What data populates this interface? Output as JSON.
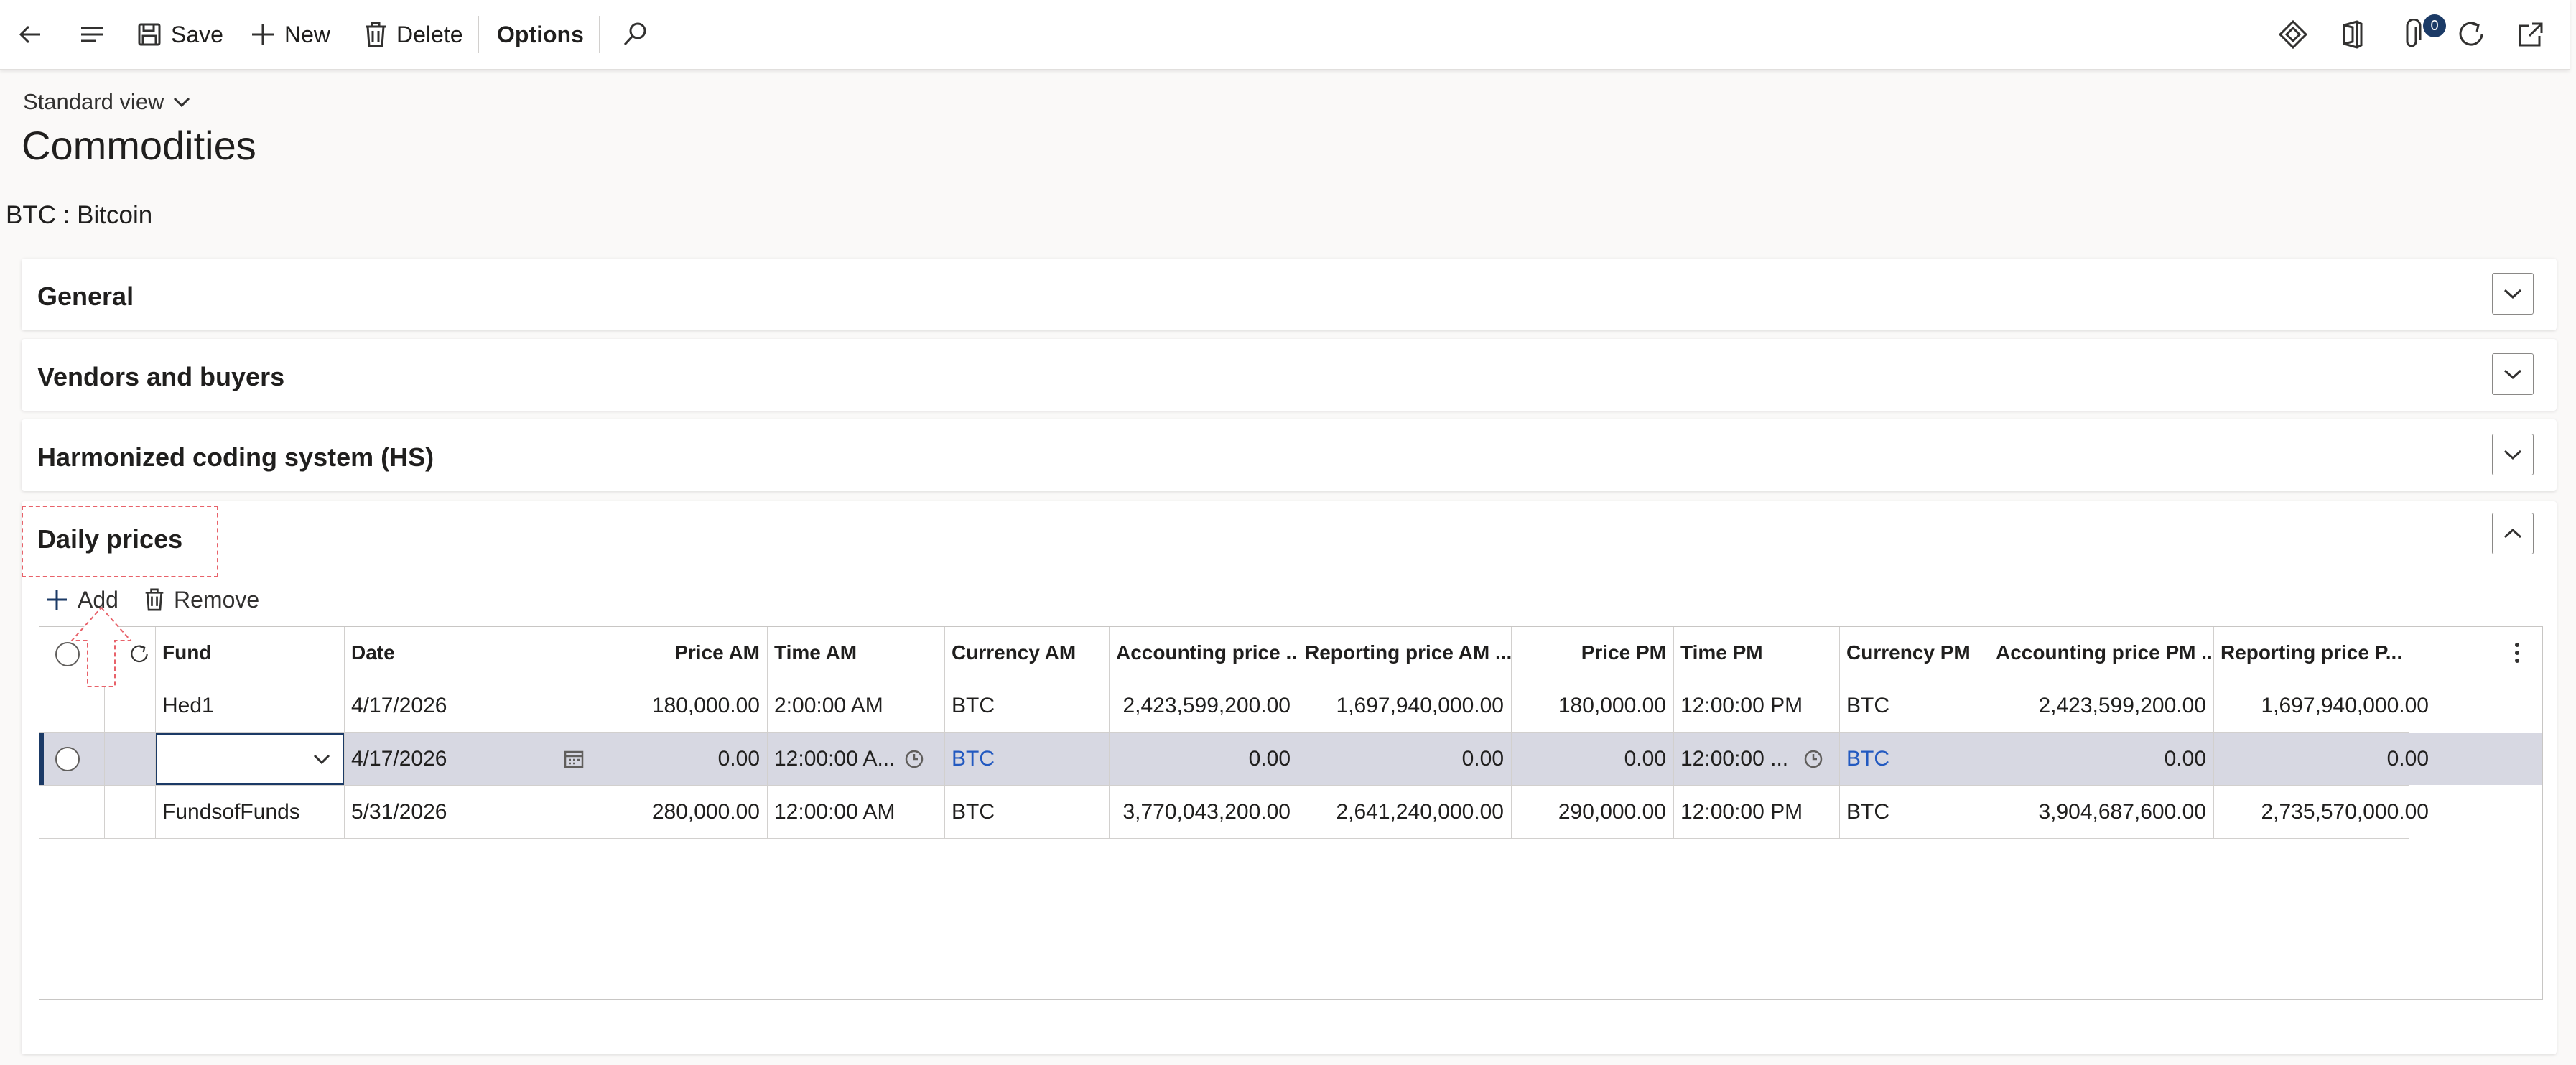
{
  "toolbar": {
    "save_label": "Save",
    "new_label": "New",
    "delete_label": "Delete",
    "options_label": "Options",
    "notification_count": "0"
  },
  "header": {
    "view_name": "Standard view",
    "page_title": "Commodities",
    "record_title": "BTC : Bitcoin"
  },
  "fasttabs": {
    "general": "General",
    "vendors": "Vendors and buyers",
    "hs": "Harmonized coding system (HS)",
    "daily": "Daily prices"
  },
  "grid": {
    "add_label": "Add",
    "remove_label": "Remove",
    "columns": {
      "fund": "Fund",
      "date": "Date",
      "price_am": "Price AM",
      "time_am": "Time AM",
      "currency_am": "Currency AM",
      "acct_price_am": "Accounting price ...",
      "rep_price_am": "Reporting price AM ...",
      "price_pm": "Price PM",
      "time_pm": "Time PM",
      "currency_pm": "Currency PM",
      "acct_price_pm": "Accounting price PM ...",
      "rep_price_pm": "Reporting price P..."
    },
    "rows": [
      {
        "fund": "Hed1",
        "date": "4/17/2026",
        "price_am": "180,000.00",
        "time_am": "2:00:00 AM",
        "currency_am": "BTC",
        "acct_price_am": "2,423,599,200.00",
        "rep_price_am": "1,697,940,000.00",
        "price_pm": "180,000.00",
        "time_pm": "12:00:00 PM",
        "currency_pm": "BTC",
        "acct_price_pm": "2,423,599,200.00",
        "rep_price_pm": "1,697,940,000.00"
      },
      {
        "fund": "",
        "date": "4/17/2026",
        "price_am": "0.00",
        "time_am": "12:00:00 A...",
        "currency_am": "BTC",
        "acct_price_am": "0.00",
        "rep_price_am": "0.00",
        "price_pm": "0.00",
        "time_pm": "12:00:00 ...",
        "currency_pm": "BTC",
        "acct_price_pm": "0.00",
        "rep_price_pm": "0.00"
      },
      {
        "fund": "FundsofFunds",
        "date": "5/31/2026",
        "price_am": "280,000.00",
        "time_am": "12:00:00 AM",
        "currency_am": "BTC",
        "acct_price_am": "3,770,043,200.00",
        "rep_price_am": "2,641,240,000.00",
        "price_pm": "290,000.00",
        "time_pm": "12:00:00 PM",
        "currency_pm": "BTC",
        "acct_price_pm": "3,904,687,600.00",
        "rep_price_pm": "2,735,570,000.00"
      }
    ]
  },
  "icons": [
    "back-arrow-icon",
    "menu-icon",
    "save-icon",
    "plus-icon",
    "trash-icon",
    "search-icon",
    "diamond-icon",
    "office-icon",
    "attachment-icon",
    "refresh-icon",
    "open-new-icon",
    "chevron-down-icon",
    "chevron-up-icon",
    "calendar-icon",
    "clock-icon",
    "more-vertical-icon"
  ],
  "colors": {
    "accent": "#1b3a66",
    "link": "#2259c0",
    "selected_row": "#d7d8e2",
    "annotation": "#e8626a"
  }
}
